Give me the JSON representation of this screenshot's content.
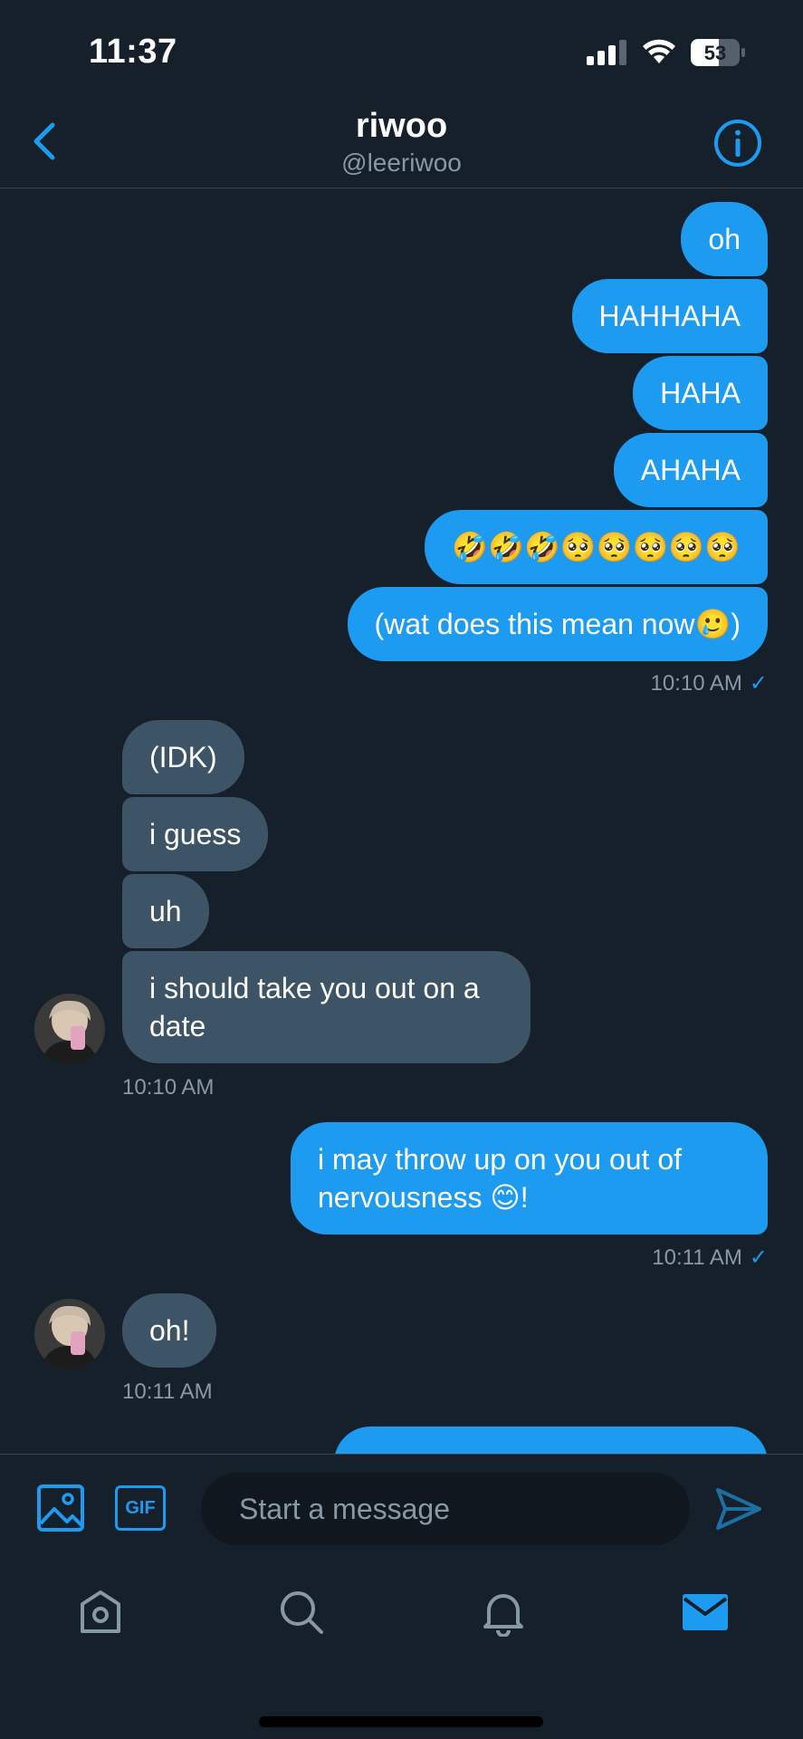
{
  "status_bar": {
    "time": "11:37",
    "battery": "53"
  },
  "header": {
    "name": "riwoo",
    "handle": "@leeriwoo"
  },
  "messages": [
    {
      "text": "oh"
    },
    {
      "text": "HAHHAHA"
    },
    {
      "text": "HAHA"
    },
    {
      "text": "AHAHA"
    },
    {
      "text": "🤣🤣🤣🥺🥺🥺🥺🥺"
    },
    {
      "text": "(wat does this mean now🥲)"
    },
    {
      "text": "(IDK)"
    },
    {
      "text": "i guess"
    },
    {
      "text": "uh"
    },
    {
      "text": "i should take you out on a date"
    },
    {
      "text": "i may throw up on you out of nervousness 😊!"
    },
    {
      "text": "oh!"
    }
  ],
  "timestamps": [
    "10:10 AM",
    "10:10 AM",
    "10:11 AM",
    "10:11 AM"
  ],
  "composer": {
    "placeholder": "Start a message",
    "gif_label": "GIF"
  },
  "colors": {
    "background": "#15202b",
    "sent_bubble": "#1d9bf0",
    "received_bubble": "#3d5466",
    "accent": "#1d9bf0",
    "muted": "#8899a6"
  }
}
